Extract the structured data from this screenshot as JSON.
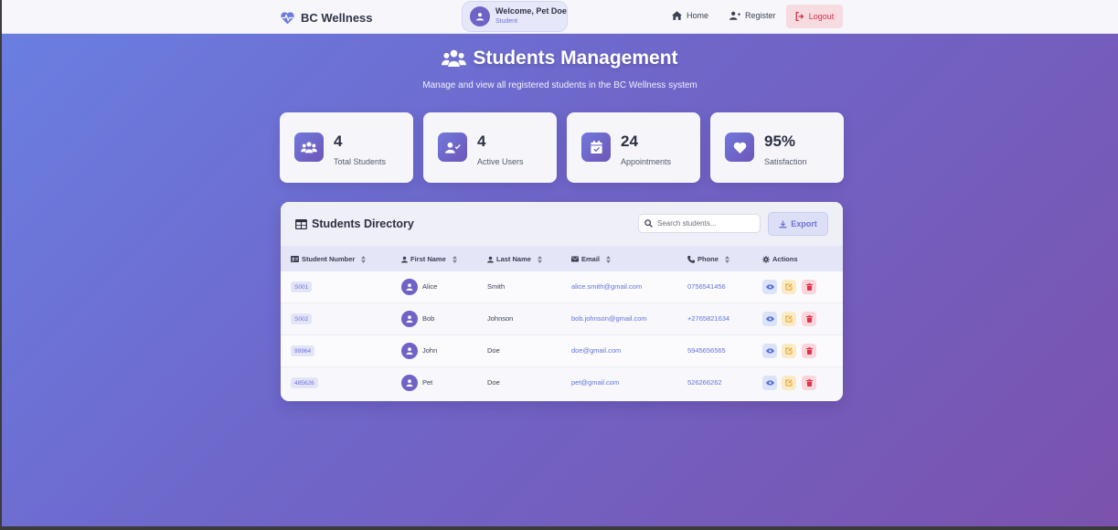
{
  "navbar": {
    "brand": "BC Wellness",
    "welcome_name": "Welcome, Pet Doe",
    "welcome_role": "Student",
    "home": "Home",
    "register": "Register",
    "logout": "Logout"
  },
  "hero": {
    "title": "Students Management",
    "subtitle": "Manage and view all registered students in the BC Wellness system"
  },
  "stats": [
    {
      "value": "4",
      "label": "Total Students",
      "icon": "users-icon"
    },
    {
      "value": "4",
      "label": "Active Users",
      "icon": "user-check-icon"
    },
    {
      "value": "24",
      "label": "Appointments",
      "icon": "calendar-icon"
    },
    {
      "value": "95%",
      "label": "Satisfaction",
      "icon": "heart-icon"
    }
  ],
  "directory": {
    "title": "Students Directory",
    "search_placeholder": "Search students...",
    "export": "Export",
    "columns": [
      "Student Number",
      "First Name",
      "Last Name",
      "Email",
      "Phone",
      "Actions"
    ],
    "rows": [
      {
        "number": "S001",
        "first": "Alice",
        "last": "Smith",
        "email": "alice.smith@gmail.com",
        "phone": "0756541456"
      },
      {
        "number": "S002",
        "first": "Bob",
        "last": "Johnson",
        "email": "bob.johnson@gmail.com",
        "phone": "+2765821634"
      },
      {
        "number": "99964",
        "first": "John",
        "last": "Doe",
        "email": "doe@gmail.com",
        "phone": "5945656565"
      },
      {
        "number": "485626",
        "first": "Pet",
        "last": "Doe",
        "email": "pet@gmail.com",
        "phone": "526266262"
      }
    ]
  },
  "colors": {
    "accent": "#6e63c7",
    "logout": "#d53049",
    "link": "#6173d8"
  }
}
